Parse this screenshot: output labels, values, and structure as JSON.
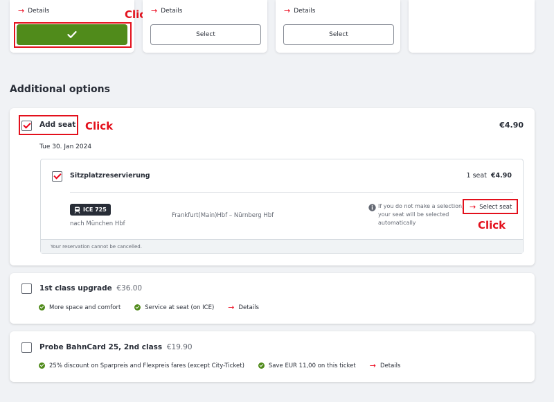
{
  "fares": [
    {
      "details_label": "Details",
      "button_state": "selected"
    },
    {
      "details_label": "Details",
      "button_label": "Select"
    },
    {
      "details_label": "Details",
      "button_label": "Select"
    }
  ],
  "section_title": "Additional options",
  "annotations": {
    "click": "Click"
  },
  "add_seat": {
    "label": "Add seat",
    "price": "€4.90",
    "date": "Tue 30. Jan 2024",
    "checked": true,
    "reservation": {
      "label": "Sitzplatzreservierung",
      "seat_count": "1 seat",
      "price": "€4.90",
      "train": "ICE 725",
      "destination": "nach München Hbf",
      "route": "Frankfurt(Main)Hbf – Nürnberg Hbf",
      "info_text": "If you do not make a selection, your seat will be selected automatically",
      "select_seat_label": "Select seat",
      "footer_note": "Your reservation cannot be cancelled."
    }
  },
  "first_class": {
    "label": "1st class upgrade",
    "price": "€36.00",
    "features": [
      "More space and comfort",
      "Service at seat (on ICE)"
    ],
    "details_label": "Details"
  },
  "bahncard": {
    "label": "Probe BahnCard 25, 2nd class",
    "price": "€19.90",
    "features": [
      "25% discount on Sparpreis and Flexpreis fares (except City-Ticket)",
      "Save EUR 11,00 on this ticket"
    ],
    "details_label": "Details"
  },
  "colors": {
    "accent_red": "#ec0016",
    "selected_green": "#508b1b",
    "annotation_red": "#e3101c"
  }
}
